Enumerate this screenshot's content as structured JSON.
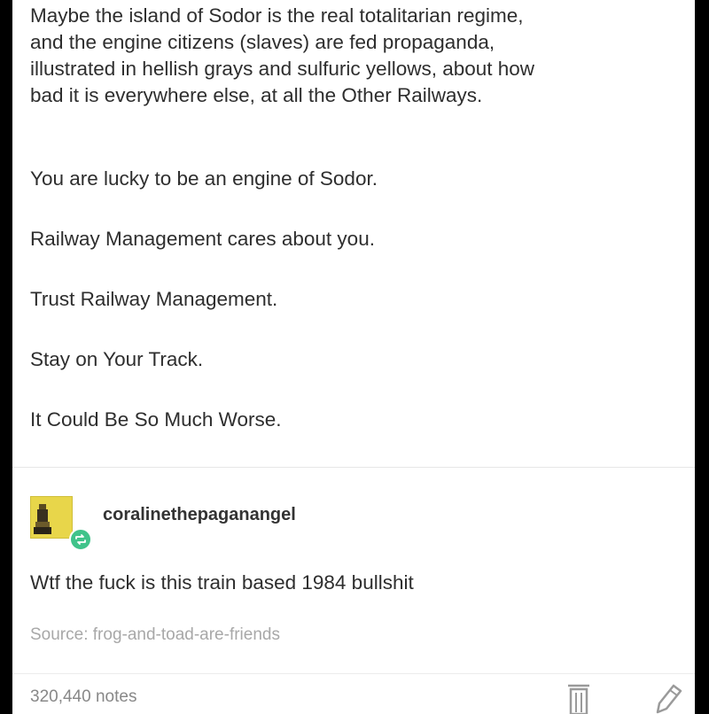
{
  "post": {
    "intro_lines": [
      "Maybe the island of Sodor is the real totalitarian regime,",
      "and the engine citizens (slaves) are fed propaganda,",
      "illustrated in hellish grays and sulfuric yellows, about how",
      "bad it is everywhere else, at all the Other Railways."
    ],
    "slogans": [
      "You are lucky to be an engine of Sodor.",
      "Railway Management cares about you.",
      "Trust Railway Management.",
      "Stay on Your Track.",
      "It Could Be So Much Worse."
    ]
  },
  "reblog": {
    "username": "coralinethepaganangel",
    "text": "Wtf the fuck is this train based 1984 bullshit",
    "avatar_icon": "avatar-yellow-figure-icon",
    "badge_icon": "reblog-icon",
    "badge_color": "#3fc38a"
  },
  "source": {
    "label": "Source:",
    "link": "frog-and-toad-are-friends"
  },
  "footer": {
    "notes": "320,440 notes",
    "delete_icon": "trash-icon",
    "edit_icon": "pencil-icon"
  }
}
